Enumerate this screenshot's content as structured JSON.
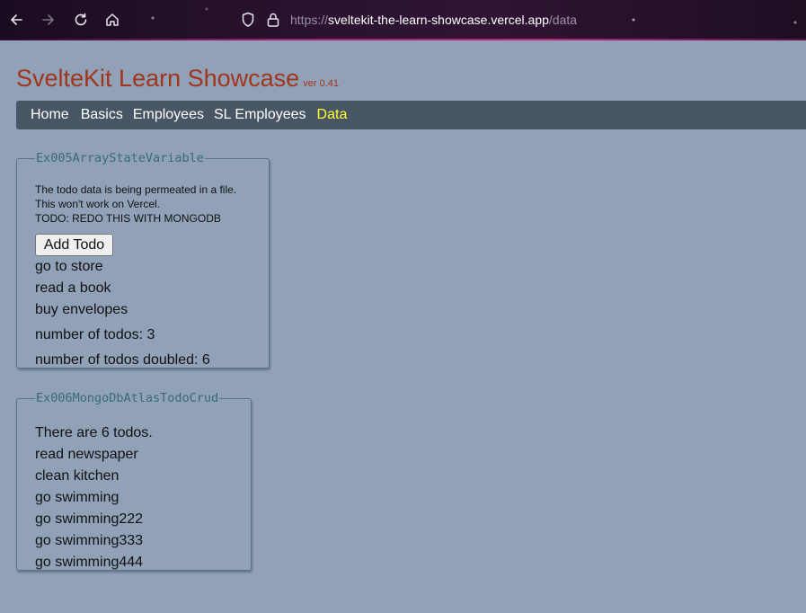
{
  "browser": {
    "url_prefix": "https://",
    "url_host": "sveltekit-the-learn-showcase.vercel.app",
    "url_path": "/data",
    "icons": [
      "back-icon",
      "forward-icon",
      "reload-icon",
      "home-icon",
      "shield-icon",
      "lock-icon"
    ]
  },
  "header": {
    "title": "SvelteKit Learn Showcase",
    "version": "ver 0.41"
  },
  "nav": {
    "items": [
      "Home",
      "Basics",
      "Employees",
      "SL Employees",
      "Data"
    ],
    "active": "Data"
  },
  "ex005": {
    "legend": "Ex005ArrayStateVariable",
    "notes": [
      "The todo data is being permeated in a file.",
      "This won't work on Vercel.",
      "TODO: REDO THIS WITH MONGODB"
    ],
    "add_button": "Add Todo",
    "todos": [
      "go to store",
      "read a book",
      "buy envelopes"
    ],
    "count_text": "number of todos: 3",
    "doubled_text": "number of todos doubled: 6"
  },
  "ex006": {
    "legend": "Ex006MongoDbAtlasTodoCrud",
    "summary": "There are 6 todos.",
    "todos": [
      "read newspaper",
      "clean kitchen",
      "go swimming",
      "go swimming222",
      "go swimming333",
      "go swimming444"
    ]
  },
  "colors": {
    "page_bg": "#91a1b8",
    "title": "#a0361c",
    "nav_bg": "#475564",
    "nav_active": "#ffff2e"
  }
}
